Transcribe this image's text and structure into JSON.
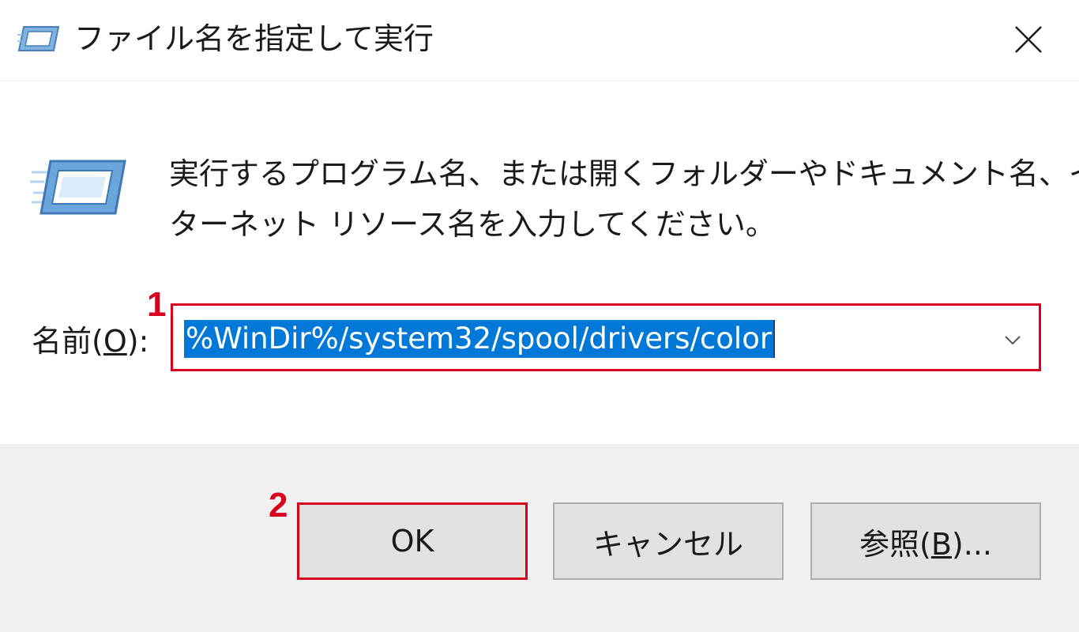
{
  "window": {
    "title": "ファイル名を指定して実行",
    "close_icon": "close-icon"
  },
  "description": {
    "line1": "実行するプログラム名、または開くフォルダーやドキュメント名、イン",
    "line2": "ターネット リソース名を入力してください。"
  },
  "name_field": {
    "label_prefix": "名前(",
    "label_mnemonic": "O",
    "label_suffix": "):",
    "value": "%WinDir%/system32/spool/drivers/color",
    "selection_color": "#0078d7"
  },
  "annotations": {
    "step1": "1",
    "step2": "2",
    "highlight_color": "#d7001e"
  },
  "buttons": {
    "ok": "OK",
    "cancel": "キャンセル",
    "browse_prefix": "参照(",
    "browse_mnemonic": "B",
    "browse_suffix": ")..."
  }
}
